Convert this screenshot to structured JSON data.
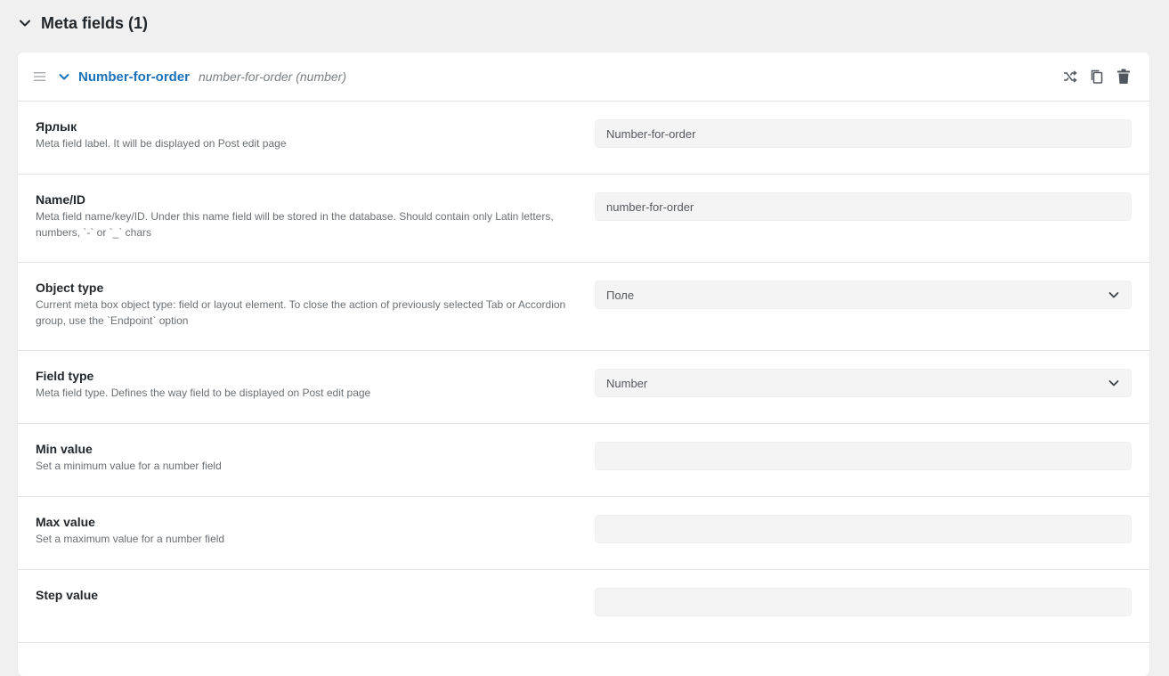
{
  "section": {
    "title": "Meta fields (1)"
  },
  "field": {
    "name": "Number-for-order",
    "meta": "number-for-order (number)"
  },
  "rows": [
    {
      "label": "Ярлык",
      "desc": "Meta field label. It will be displayed on Post edit page",
      "value": "Number-for-order",
      "type": "input"
    },
    {
      "label": "Name/ID",
      "desc": "Meta field name/key/ID. Under this name field will be stored in the database. Should contain only Latin letters, numbers, `-` or `_` chars",
      "value": "number-for-order",
      "type": "input"
    },
    {
      "label": "Object type",
      "desc": "Current meta box object type: field or layout element. To close the action of previously selected Tab or Accordion group, use the `Endpoint` option",
      "value": "Поле",
      "type": "select"
    },
    {
      "label": "Field type",
      "desc": "Meta field type. Defines the way field to be displayed on Post edit page",
      "value": "Number",
      "type": "select"
    },
    {
      "label": "Min value",
      "desc": "Set a minimum value for a number field",
      "value": "",
      "type": "input"
    },
    {
      "label": "Max value",
      "desc": "Set a maximum value for a number field",
      "value": "",
      "type": "input"
    },
    {
      "label": "Step value",
      "desc": "",
      "value": "",
      "type": "input"
    }
  ],
  "icons": {
    "collapse": "chevron-down-icon",
    "drag": "drag-handle-icon",
    "shuffle": "shuffle-icon",
    "copy": "copy-icon",
    "delete": "trash-icon"
  },
  "colors": {
    "accent": "#1b72b9",
    "panel": "#ffffff",
    "background": "#f0f0f0"
  }
}
